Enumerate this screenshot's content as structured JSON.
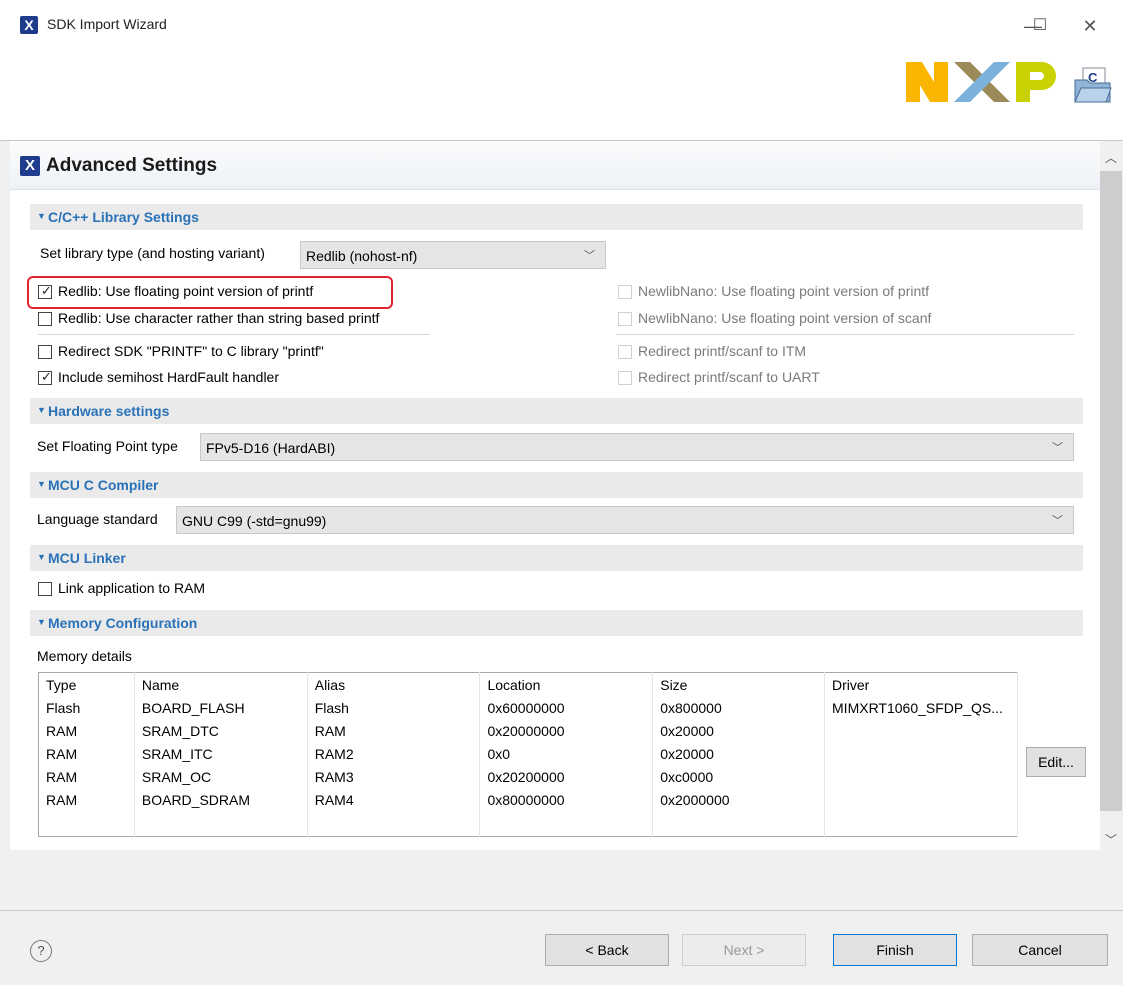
{
  "window": {
    "title": "SDK Import Wizard",
    "controls": {
      "minimize": "—",
      "maximize": "☐",
      "close": "✕"
    },
    "logo": "NXP"
  },
  "page": {
    "title": "Advanced Settings"
  },
  "library_section": {
    "title": "C/C++ Library Settings",
    "library_type_label": "Set library type (and hosting variant)",
    "library_type_value": "Redlib (nohost-nf)",
    "options_left": [
      {
        "label": "Redlib: Use floating point version of printf",
        "checked": true
      },
      {
        "label": "Redlib: Use character rather than string based printf",
        "checked": false
      },
      {
        "label": "Redirect SDK \"PRINTF\" to C library \"printf\"",
        "checked": false
      },
      {
        "label": "Include semihost HardFault handler",
        "checked": true
      }
    ],
    "options_right": [
      {
        "label": "NewlibNano: Use floating point version of printf",
        "checked": false,
        "enabled": false
      },
      {
        "label": "NewlibNano: Use floating point version of scanf",
        "checked": false,
        "enabled": false
      },
      {
        "label": "Redirect printf/scanf to ITM",
        "checked": false,
        "enabled": false
      },
      {
        "label": "Redirect printf/scanf to UART",
        "checked": false,
        "enabled": false
      }
    ]
  },
  "hardware_section": {
    "title": "Hardware settings",
    "fp_label": "Set Floating Point type",
    "fp_value": "FPv5-D16 (HardABI)"
  },
  "compiler_section": {
    "title": "MCU C Compiler",
    "lang_label": "Language standard",
    "lang_value": "GNU C99 (-std=gnu99)"
  },
  "linker_section": {
    "title": "MCU Linker",
    "link_ram_label": "Link application to RAM",
    "link_ram_checked": false
  },
  "memory_section": {
    "title": "Memory Configuration",
    "details_label": "Memory details",
    "columns": [
      "Type",
      "Name",
      "Alias",
      "Location",
      "Size",
      "Driver"
    ],
    "rows": [
      [
        "Flash",
        "BOARD_FLASH",
        "Flash",
        "0x60000000",
        "0x800000",
        "MIMXRT1060_SFDP_QS..."
      ],
      [
        "RAM",
        "SRAM_DTC",
        "RAM",
        "0x20000000",
        "0x20000",
        ""
      ],
      [
        "RAM",
        "SRAM_ITC",
        "RAM2",
        "0x0",
        "0x20000",
        ""
      ],
      [
        "RAM",
        "SRAM_OC",
        "RAM3",
        "0x20200000",
        "0xc0000",
        ""
      ],
      [
        "RAM",
        "BOARD_SDRAM",
        "RAM4",
        "0x80000000",
        "0x2000000",
        ""
      ]
    ],
    "edit_label": "Edit..."
  },
  "footer": {
    "help": "?",
    "back": "< Back",
    "next": "Next >",
    "finish": "Finish",
    "cancel": "Cancel"
  },
  "colors": {
    "accent": "#2a72b8",
    "highlight": "#e0252e",
    "nxp_yellow": "#f9b500",
    "nxp_blue": "#7bb1db",
    "nxp_green": "#c9d200"
  }
}
